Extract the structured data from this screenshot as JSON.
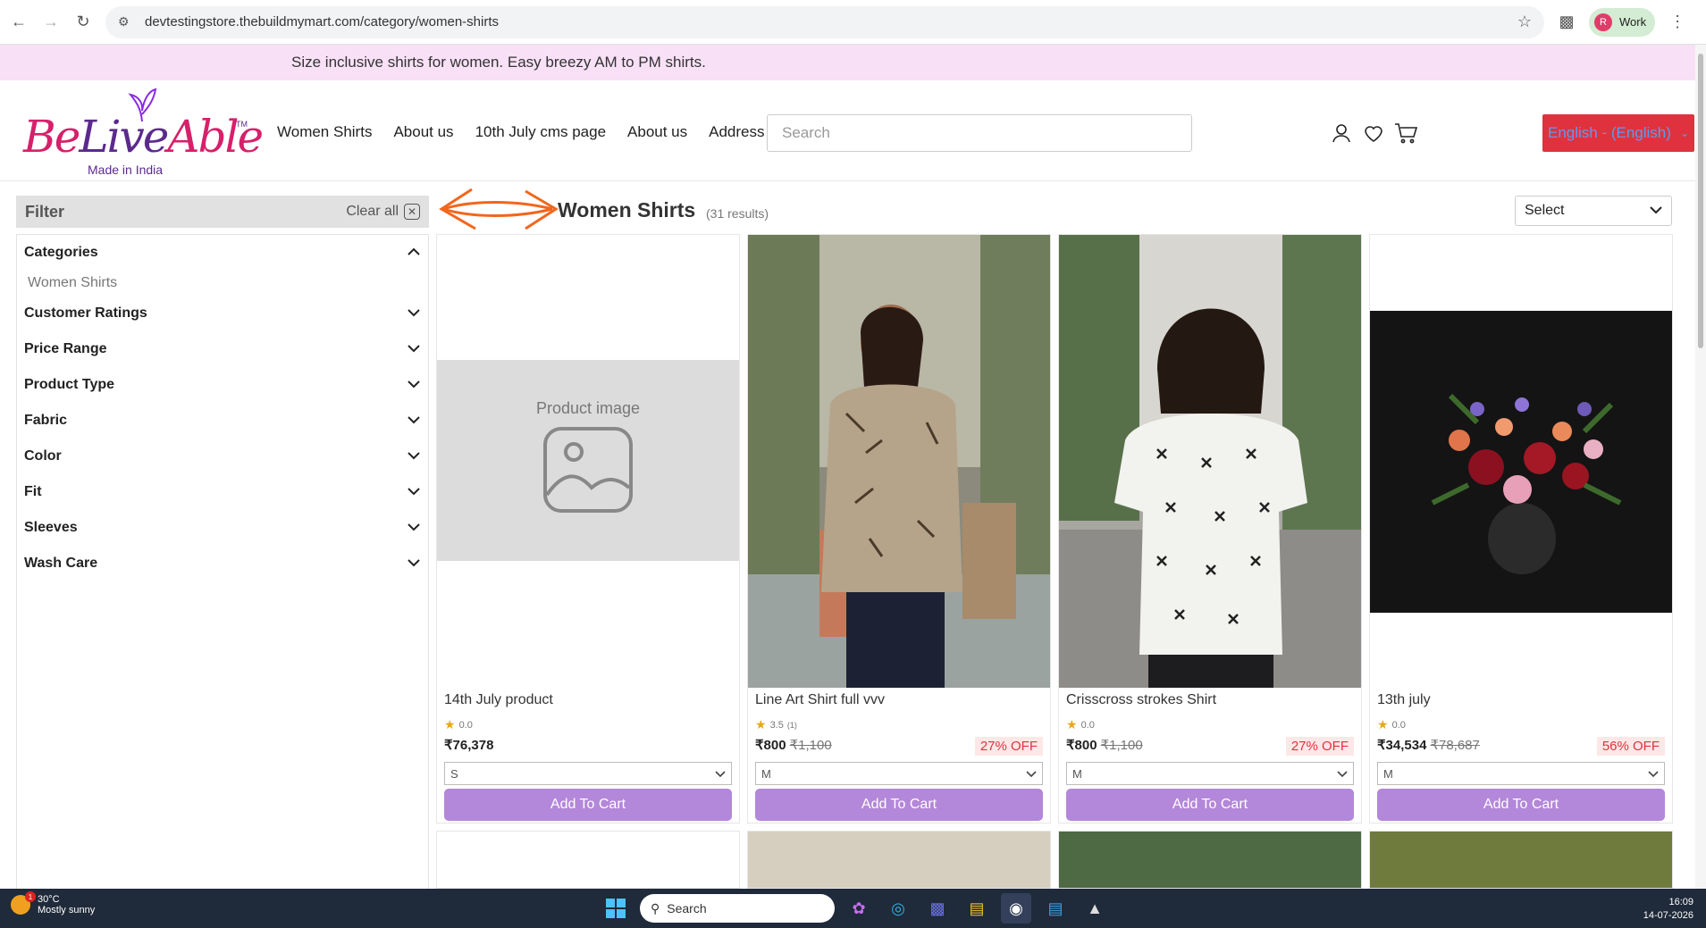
{
  "browser": {
    "url": "devtestingstore.thebuildmymart.com/category/women-shirts",
    "profile_initial": "R",
    "profile_label": "Work"
  },
  "announcement": "Size inclusive shirts for women. Easy breezy AM to PM shirts.",
  "logo": {
    "part1": "Be",
    "part2": "Live",
    "part3": "Able",
    "tagline": "Made in India",
    "tm": "TM"
  },
  "nav": [
    "Women Shirts",
    "About us",
    "10th July cms page",
    "About us",
    "Address"
  ],
  "search": {
    "placeholder": "Search"
  },
  "language": "English - (English)",
  "filter": {
    "title": "Filter",
    "clear_label": "Clear all",
    "groups": [
      {
        "label": "Categories",
        "expanded": true,
        "items": [
          "Women Shirts"
        ]
      },
      {
        "label": "Customer Ratings"
      },
      {
        "label": "Price Range"
      },
      {
        "label": "Product Type"
      },
      {
        "label": "Fabric"
      },
      {
        "label": "Color"
      },
      {
        "label": "Fit"
      },
      {
        "label": "Sleeves"
      },
      {
        "label": "Wash Care"
      }
    ]
  },
  "results": {
    "title": "Women Shirts",
    "count": "(31 results)",
    "sort_label": "Select"
  },
  "products": [
    {
      "name": "14th July product",
      "rating": "0.0",
      "rating_count": "",
      "price": "₹76,378",
      "old_price": "",
      "off": "",
      "size": "S",
      "cta": "Add To Cart",
      "image": "placeholder",
      "placeholder_text": "Product image"
    },
    {
      "name": "Line Art Shirt full vvv",
      "rating": "3.5",
      "rating_count": "(1)",
      "price": "₹800",
      "old_price": "₹1,100",
      "off": "27% OFF",
      "size": "M",
      "cta": "Add To Cart",
      "image": "woman-patterned-shirt-front"
    },
    {
      "name": "Crisscross strokes Shirt",
      "rating": "0.0",
      "rating_count": "",
      "price": "₹800",
      "old_price": "₹1,100",
      "off": "27% OFF",
      "size": "M",
      "cta": "Add To Cart",
      "image": "woman-white-shirt-back"
    },
    {
      "name": "13th july",
      "rating": "0.0",
      "rating_count": "",
      "price": "₹34,534",
      "old_price": "₹78,687",
      "off": "56% OFF",
      "size": "M",
      "cta": "Add To Cart",
      "image": "flower-bouquet"
    }
  ],
  "taskbar": {
    "temp": "30°C",
    "weather": "Mostly sunny",
    "search_label": "Search",
    "time": "16:09",
    "date": "14-07-2026"
  },
  "colors": {
    "announcement_bg": "#f8e0f6",
    "cta_bg": "#b387d9",
    "lang_bg": "#e0323e",
    "discount": "#e0323e",
    "brand_pink": "#d6206a",
    "brand_purple": "#5c2a8c"
  }
}
